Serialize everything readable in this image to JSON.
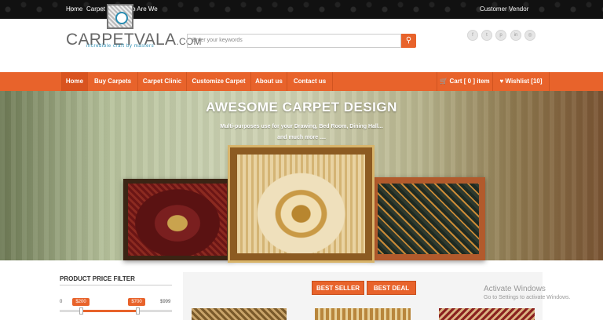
{
  "topbar": {
    "links": [
      "Home",
      "Carpet Clinic",
      "Who Are We"
    ],
    "account_links": [
      "Customer",
      "Vendor"
    ]
  },
  "header": {
    "logo_name": "CARPETVALA",
    "logo_suffix": ".COM",
    "logo_tagline": "incredible craft by masters",
    "search_placeholder": "Enter your keywords",
    "search_icon": "search-icon",
    "social_icons": [
      "facebook-icon",
      "twitter-icon",
      "pinterest-icon",
      "linkedin-icon",
      "instagram-icon"
    ],
    "social_glyphs": [
      "f",
      "t",
      "p",
      "in",
      "◎"
    ]
  },
  "nav": {
    "items": [
      "Home",
      "Buy Carpets",
      "Carpet Clinic",
      "Customize Carpet",
      "About us",
      "Contact us"
    ],
    "cart": "Cart [ 0 ] item",
    "wishlist": "Wishlist [10]"
  },
  "banner": {
    "title": "AWESOME CARPET DESIGN",
    "subtitle_line1": "Multi-purposes use for your Drawing, Bed Room, Dining Hall...",
    "subtitle_line2": "and much more ...."
  },
  "price_filter": {
    "title": "PRODUCT PRICE FILTER",
    "min": "0",
    "max": "$999",
    "low_value": "$200",
    "high_value": "$700"
  },
  "product_tabs": [
    "BEST SELLER",
    "BEST DEAL"
  ],
  "watermark": {
    "line1": "Activate Windows",
    "line2": "Go to Settings to activate Windows."
  },
  "colors": {
    "accent": "#e8632b",
    "topbar": "#111111"
  }
}
